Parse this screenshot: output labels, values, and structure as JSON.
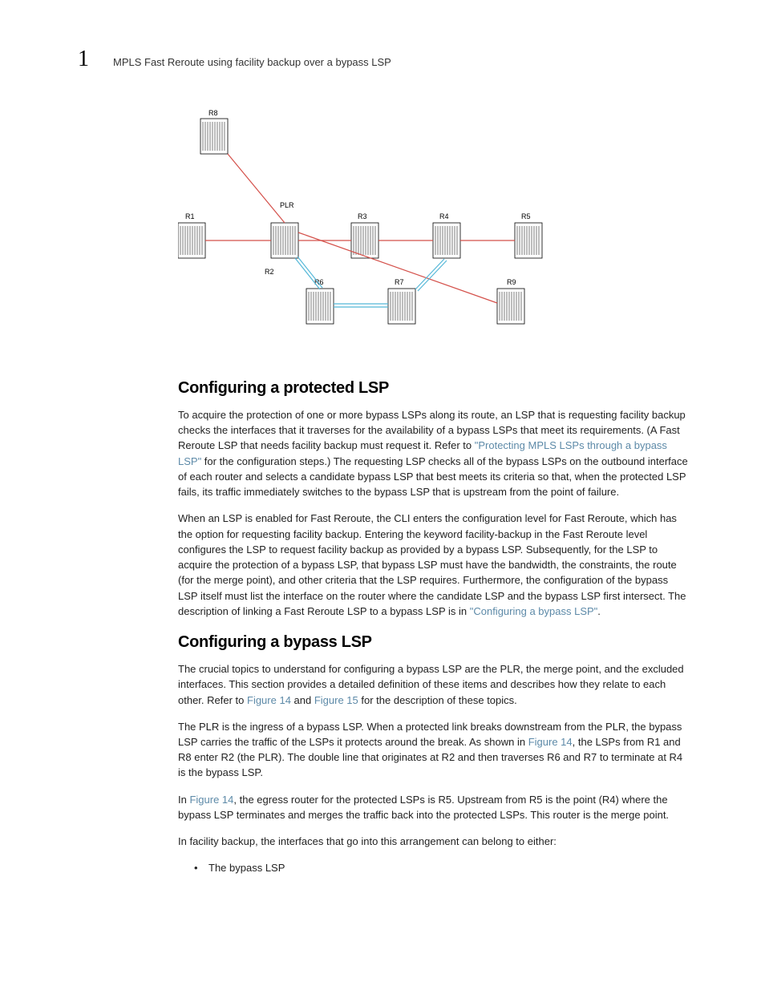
{
  "header": {
    "chapter_number": "1",
    "running_title": "MPLS Fast Reroute using facility backup over a bypass LSP"
  },
  "diagram": {
    "nodes": {
      "R1": "R1",
      "R2": "R2",
      "R3": "R3",
      "R4": "R4",
      "R5": "R5",
      "R6": "R6",
      "R7": "R7",
      "R8": "R8",
      "R9": "R9",
      "PLR": "PLR"
    }
  },
  "section1": {
    "heading": "Configuring a protected LSP",
    "p1_a": "To acquire the protection of one or more bypass LSPs along its route, an LSP that is requesting facility backup checks the interfaces that it traverses for the availability of a bypass LSPs that meet its requirements. (A Fast Reroute LSP that needs facility backup must request it. Refer to ",
    "p1_link": "\"Protecting MPLS LSPs through a bypass LSP\"",
    "p1_b": " for the configuration steps.) The requesting LSP checks all of the bypass LSPs on the outbound interface of each router and selects a candidate bypass LSP that best meets its criteria so that, when the protected LSP fails, its traffic immediately switches to the bypass LSP that is upstream from the point of failure.",
    "p2_a": "When an LSP is enabled for Fast Reroute, the CLI enters the configuration level for Fast Reroute, which has the option for requesting facility backup. Entering the keyword facility-backup in the Fast Reroute level configures the LSP to request facility backup as provided by a bypass LSP. Subsequently, for the LSP to acquire the protection of a bypass LSP, that bypass LSP must have the bandwidth, the constraints, the route (for the merge point), and other criteria that the LSP requires. Furthermore, the configuration of the bypass LSP itself must list the interface on the router where the candidate LSP and the bypass LSP first intersect. The description of linking a Fast Reroute LSP to a bypass LSP is in ",
    "p2_link": "\"Configuring a bypass LSP\"",
    "p2_b": "."
  },
  "section2": {
    "heading": "Configuring a bypass LSP",
    "p1_a": "The crucial topics to understand for configuring a bypass LSP are the PLR, the merge point, and the excluded interfaces. This section provides a detailed definition of these items and describes how they relate to each other. Refer to ",
    "p1_link1": "Figure 14",
    "p1_mid": " and ",
    "p1_link2": "Figure 15",
    "p1_b": " for the description of these topics.",
    "p2_a": "The PLR is the ingress of a bypass LSP. When a protected link breaks downstream from the PLR, the bypass LSP carries the traffic of the LSPs it protects around the break. As shown in ",
    "p2_link": "Figure 14",
    "p2_b": ", the LSPs from R1 and R8 enter R2 (the PLR). The double line that originates at R2 and then traverses R6 and R7 to terminate at R4 is the bypass LSP.",
    "p3_a": "In ",
    "p3_link": "Figure 14",
    "p3_b": ", the egress router for the protected LSPs is R5. Upstream from R5 is the point (R4) where the bypass LSP terminates and merges the traffic back into the protected LSPs. This router is the merge point.",
    "p4": "In facility backup, the interfaces that go into this arrangement can belong to either:",
    "bullet1": "The bypass LSP"
  }
}
